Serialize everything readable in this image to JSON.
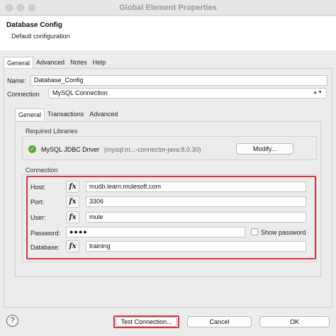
{
  "window": {
    "title": "Global Element Properties"
  },
  "header": {
    "title": "Database Config",
    "subtitle": "Default configuration"
  },
  "tabs": [
    "General",
    "Advanced",
    "Notes",
    "Help"
  ],
  "form": {
    "name_label": "Name:",
    "name_value": "Database_Config",
    "connection_label": "Connection",
    "connection_value": "MySQL Connection"
  },
  "inner_tabs": [
    "General",
    "Transactions",
    "Advanced"
  ],
  "libraries": {
    "group_label": "Required Libraries",
    "driver_name": "MySQL JDBC Driver",
    "driver_detail": "(mysql:m...-connector-java:8.0.30)",
    "modify_label": "Modify..."
  },
  "connection": {
    "group_label": "Connection",
    "host_label": "Host:",
    "host_value": "mudb.learn.mulesoft.com",
    "port_label": "Port:",
    "port_value": "3306",
    "user_label": "User:",
    "user_value": "mule",
    "password_label": "Password:",
    "password_value": "●●●●",
    "show_password_label": "Show password",
    "database_label": "Database:",
    "database_value": "training",
    "fx_label": "fx"
  },
  "footer": {
    "help": "?",
    "test_connection": "Test Connection...",
    "cancel": "Cancel",
    "ok": "OK"
  },
  "colors": {
    "highlight": "#d9363e",
    "success": "#5aa83a"
  }
}
